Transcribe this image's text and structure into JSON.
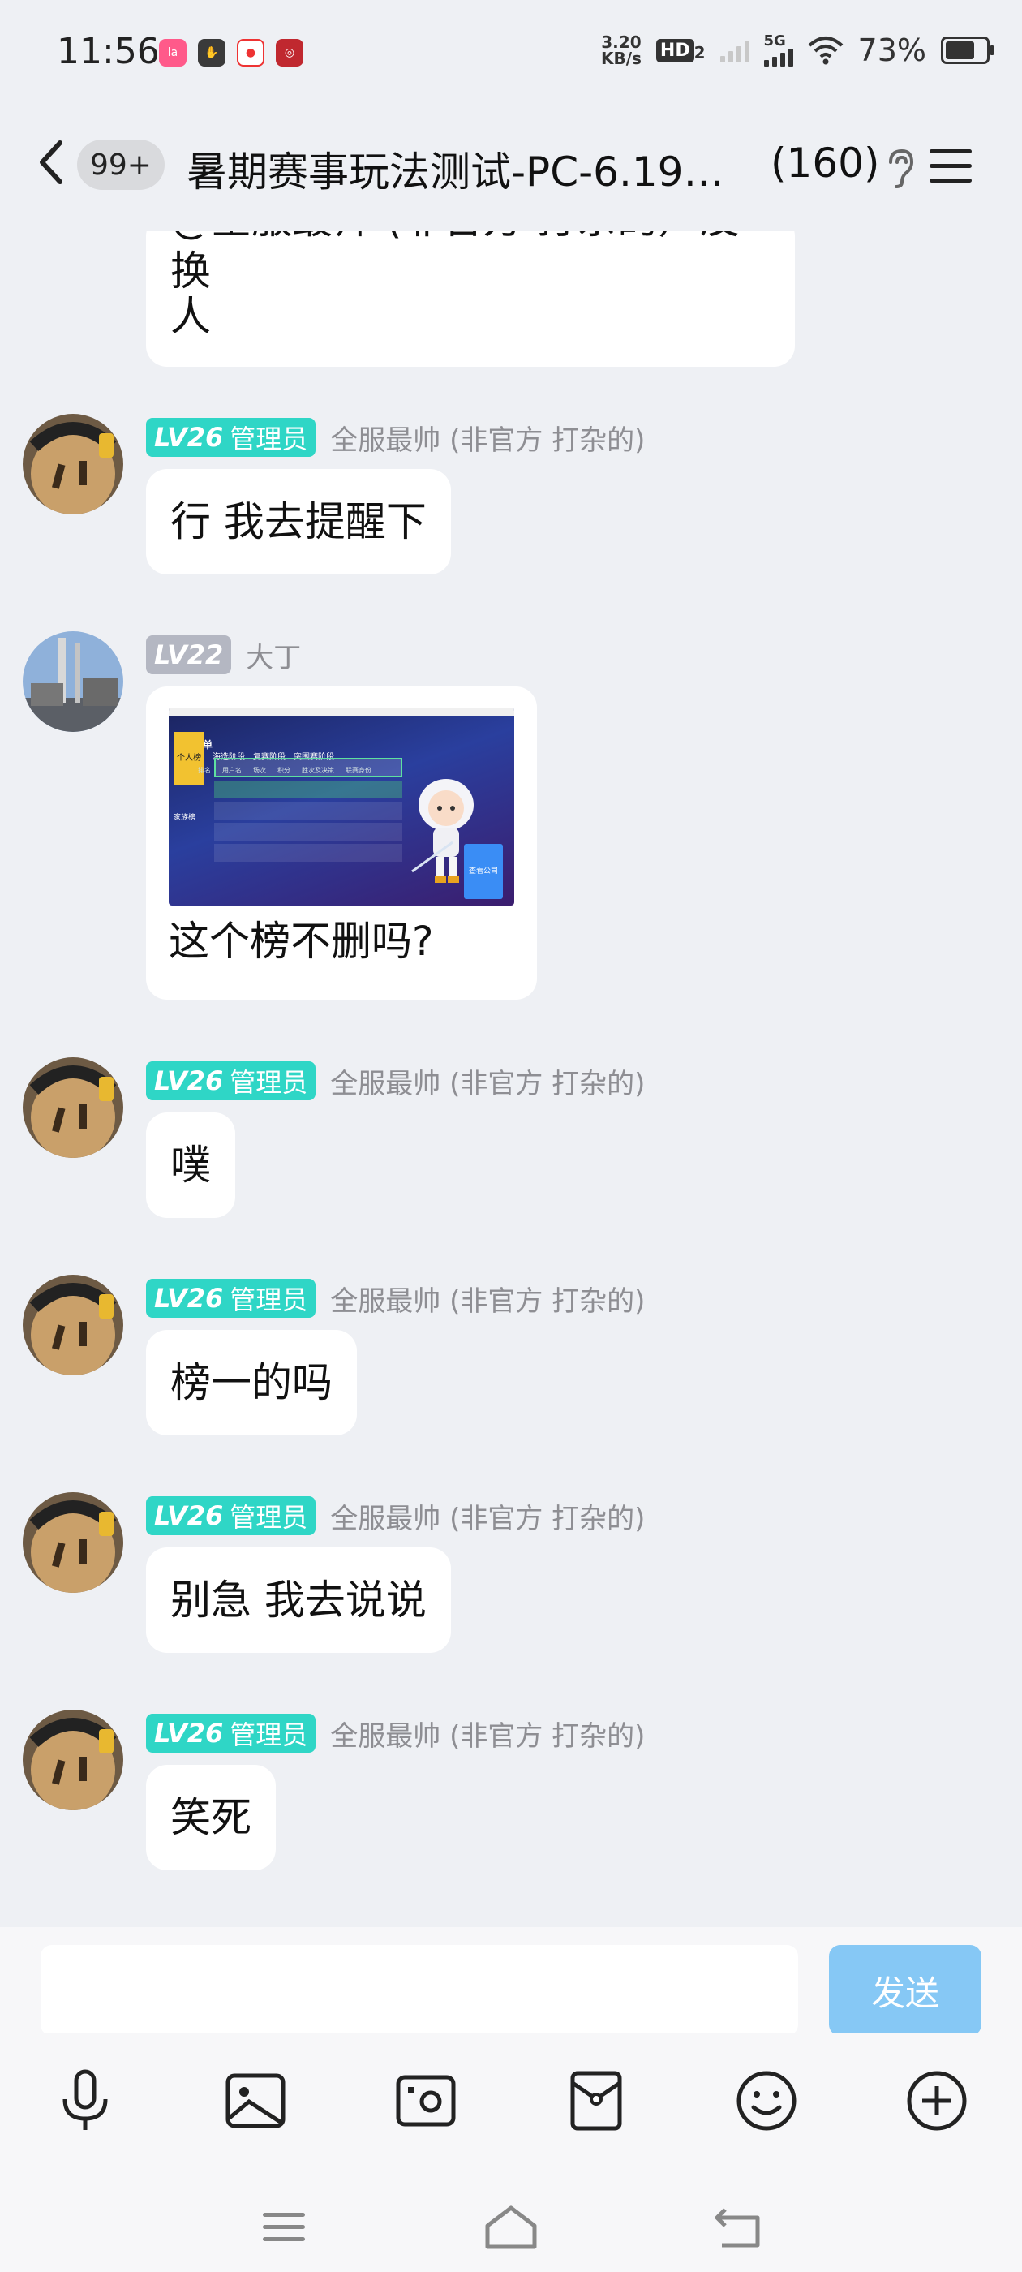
{
  "status_bar": {
    "time": "11:56",
    "net_speed_value": "3.20",
    "net_speed_unit": "KB/s",
    "hd_badge": "HD",
    "hd_sub": "2",
    "network_type": "5G",
    "battery_percent": "73%",
    "battery_level": 0.73,
    "app_icons": [
      "lala-app-icon",
      "hand-app-icon",
      "map-pin-app-icon",
      "red-app-icon"
    ]
  },
  "header": {
    "unread_badge": "99+",
    "group_title": "暑期赛事玩法测试-PC-6.19…",
    "member_count": "(160)"
  },
  "messages": [
    {
      "text": "@全服最帅 (非官方 打杂的）没换人",
      "text_line1": "@全服最帅 (非官方 打杂的）没换",
      "text_line2": "人"
    },
    {
      "level": "LV26",
      "role": "管理员",
      "sender": "全服最帅 (非官方 打杂的)",
      "text": "行 我去提醒下"
    },
    {
      "level": "LV22",
      "sender": "大丁",
      "image_caption": "这个榜不删吗?",
      "image": {
        "title": "追风榜单",
        "tabs": [
          "个人榜",
          "海选阶段",
          "复赛阶段",
          "突围赛阶段"
        ],
        "side_tabs": [
          "家族榜"
        ],
        "columns": [
          "排名",
          "用户名",
          "场次",
          "积分",
          "胜次及决策",
          "联赛身份"
        ],
        "button": "查看公司"
      }
    },
    {
      "level": "LV26",
      "role": "管理员",
      "sender": "全服最帅 (非官方 打杂的)",
      "text": "噗"
    },
    {
      "level": "LV26",
      "role": "管理员",
      "sender": "全服最帅 (非官方 打杂的)",
      "text": "榜一的吗"
    },
    {
      "level": "LV26",
      "role": "管理员",
      "sender": "全服最帅 (非官方 打杂的)",
      "text": "别急 我去说说"
    },
    {
      "level": "LV26",
      "role": "管理员",
      "sender": "全服最帅 (非官方 打杂的)",
      "text": "笑死"
    }
  ],
  "input": {
    "value": "",
    "send_label": "发送"
  },
  "toolbar": [
    "microphone-icon",
    "image-icon",
    "camera-icon",
    "red-packet-icon",
    "emoji-icon",
    "plus-icon"
  ],
  "colors": {
    "background": "#eef0f4",
    "admin_badge": "#2fd6c6",
    "level_badge_gray": "#b4b7c2",
    "send_button": "#86c8f5"
  }
}
